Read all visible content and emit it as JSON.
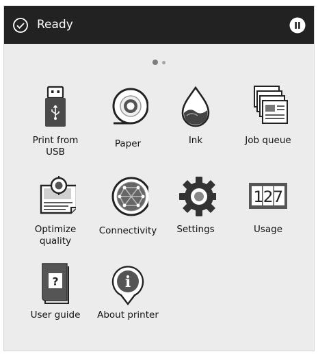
{
  "status_bar": {
    "status_text": "Ready",
    "status_icon": "check-circle-icon",
    "pause_icon": "pause-icon"
  },
  "pager": {
    "page_count": 2,
    "current_page": 1
  },
  "tiles": [
    {
      "label": "Print from\nUSB",
      "icon": "usb-drive-icon"
    },
    {
      "label": "Paper",
      "icon": "paper-roll-icon"
    },
    {
      "label": "Ink",
      "icon": "ink-drop-icon"
    },
    {
      "label": "Job queue",
      "icon": "job-queue-icon"
    },
    {
      "label": "Optimize\nquality",
      "icon": "optimize-quality-icon"
    },
    {
      "label": "Connectivity",
      "icon": "connectivity-icon"
    },
    {
      "label": "Settings",
      "icon": "gear-icon"
    },
    {
      "label": "Usage",
      "icon": "counter-icon"
    },
    {
      "label": "User guide",
      "icon": "user-guide-icon"
    },
    {
      "label": "About printer",
      "icon": "info-icon"
    }
  ],
  "usage_counter": "127",
  "user_guide_glyph": "?",
  "about_glyph": "i"
}
